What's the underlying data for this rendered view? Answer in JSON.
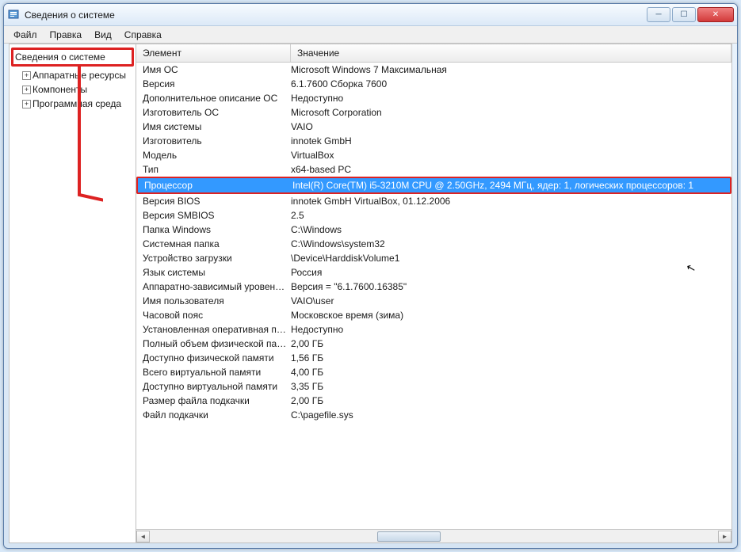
{
  "window": {
    "title": "Сведения о системе"
  },
  "menu": {
    "file": "Файл",
    "edit": "Правка",
    "view": "Вид",
    "help": "Справка"
  },
  "tree": {
    "root": "Сведения о системе",
    "children": [
      {
        "label": "Аппаратные ресурсы"
      },
      {
        "label": "Компоненты"
      },
      {
        "label": "Программная среда"
      }
    ]
  },
  "columns": {
    "element": "Элемент",
    "value": "Значение"
  },
  "rows": [
    {
      "element": "Имя ОС",
      "value": "Microsoft Windows 7 Максимальная",
      "selected": false
    },
    {
      "element": "Версия",
      "value": "6.1.7600 Сборка 7600",
      "selected": false
    },
    {
      "element": "Дополнительное описание ОС",
      "value": "Недоступно",
      "selected": false
    },
    {
      "element": "Изготовитель ОС",
      "value": "Microsoft Corporation",
      "selected": false
    },
    {
      "element": "Имя системы",
      "value": "VAIO",
      "selected": false
    },
    {
      "element": "Изготовитель",
      "value": "innotek GmbH",
      "selected": false
    },
    {
      "element": "Модель",
      "value": "VirtualBox",
      "selected": false
    },
    {
      "element": "Тип",
      "value": "x64-based PC",
      "selected": false
    },
    {
      "element": "Процессор",
      "value": "Intel(R) Core(TM) i5-3210M CPU @ 2.50GHz, 2494 МГц, ядер: 1, логических процессоров: 1",
      "selected": true
    },
    {
      "element": "Версия BIOS",
      "value": "innotek GmbH VirtualBox, 01.12.2006",
      "selected": false
    },
    {
      "element": "Версия SMBIOS",
      "value": "2.5",
      "selected": false
    },
    {
      "element": "Папка Windows",
      "value": "C:\\Windows",
      "selected": false
    },
    {
      "element": "Системная папка",
      "value": "C:\\Windows\\system32",
      "selected": false
    },
    {
      "element": "Устройство загрузки",
      "value": "\\Device\\HarddiskVolume1",
      "selected": false
    },
    {
      "element": "Язык системы",
      "value": "Россия",
      "selected": false
    },
    {
      "element": "Аппаратно-зависимый уровен…",
      "value": "Версия = \"6.1.7600.16385\"",
      "selected": false
    },
    {
      "element": "Имя пользователя",
      "value": "VAIO\\user",
      "selected": false
    },
    {
      "element": "Часовой пояс",
      "value": "Московское время (зима)",
      "selected": false
    },
    {
      "element": "Установленная оперативная п…",
      "value": "Недоступно",
      "selected": false
    },
    {
      "element": "Полный объем физической па…",
      "value": "2,00 ГБ",
      "selected": false
    },
    {
      "element": "Доступно физической памяти",
      "value": "1,56 ГБ",
      "selected": false
    },
    {
      "element": "Всего виртуальной памяти",
      "value": "4,00 ГБ",
      "selected": false
    },
    {
      "element": "Доступно виртуальной памяти",
      "value": "3,35 ГБ",
      "selected": false
    },
    {
      "element": "Размер файла подкачки",
      "value": "2,00 ГБ",
      "selected": false
    },
    {
      "element": "Файл подкачки",
      "value": "C:\\pagefile.sys",
      "selected": false
    }
  ]
}
